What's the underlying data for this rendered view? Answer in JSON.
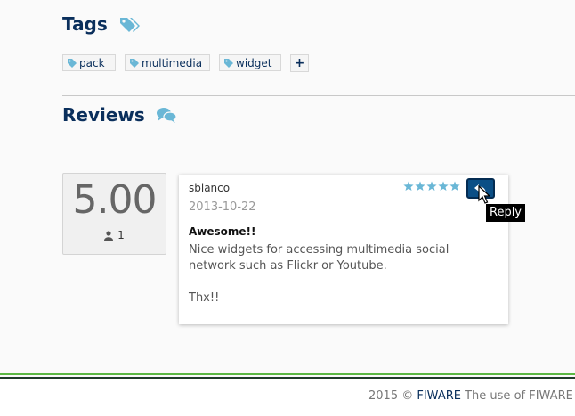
{
  "tags_section": {
    "title": "Tags",
    "items": [
      "pack",
      "multimedia",
      "widget"
    ],
    "add_label": "+"
  },
  "reviews_section": {
    "title": "Reviews",
    "rating": {
      "average": "5.00",
      "count": "1"
    },
    "review": {
      "author": "sblanco",
      "date": "2013-10-22",
      "stars": 5,
      "title": "Awesome!!",
      "body_line1": "Nice widgets for accessing multimedia social network such as Flickr or Youtube.",
      "body_line2": "Thx!!"
    },
    "reply_tooltip": "Reply"
  },
  "footer": {
    "year": "2015 ©",
    "brand": "FIWARE",
    "text": "The use of FIWARE"
  },
  "colors": {
    "heading": "#0a2f5c",
    "accent_icon": "#6ab7d6",
    "reply_button": "#0b4f86",
    "footer_green": "#5bb843"
  },
  "icons": [
    "tags-icon",
    "tag-icon",
    "comments-icon",
    "user-icon",
    "star-icon",
    "reply-icon",
    "plus-icon"
  ]
}
